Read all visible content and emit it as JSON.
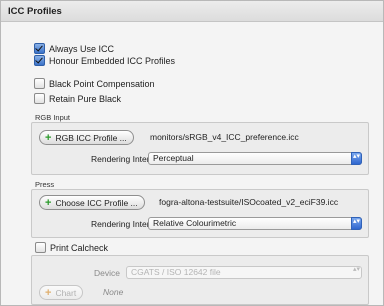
{
  "panel": {
    "title": "ICC Profiles"
  },
  "checkboxes": {
    "always_use_icc": {
      "label": "Always Use ICC",
      "checked": true
    },
    "honour_embedded": {
      "label": "Honour Embedded ICC Profiles",
      "checked": true
    },
    "black_point": {
      "label": "Black Point Compensation",
      "checked": false
    },
    "retain_black": {
      "label": "Retain Pure Black",
      "checked": false
    }
  },
  "rgb_input": {
    "group_label": "RGB Input",
    "button_label": "RGB ICC Profile ...",
    "profile_path": "monitors/sRGB_v4_ICC_preference.icc",
    "intent_label": "Rendering Intent:",
    "intent_value": "Perceptual"
  },
  "press": {
    "group_label": "Press",
    "button_label": "Choose ICC Profile ...",
    "profile_path": "fogra-altona-testsuite/ISOcoated_v2_eciF39.icc",
    "intent_label": "Rendering Intent:",
    "intent_value": "Relative Colourimetric"
  },
  "calcheck": {
    "checkbox_label": "Print Calcheck",
    "checked": false,
    "device_label": "Device",
    "device_value": "CGATS / ISO 12642 file",
    "chart_button": "Chart",
    "chart_value": "None"
  },
  "icons": {
    "plus": "+",
    "select_arrows": "▴▾"
  }
}
